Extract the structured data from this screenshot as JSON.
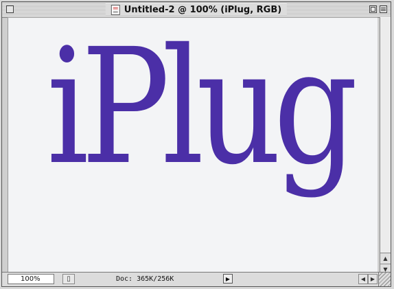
{
  "window": {
    "title": "Untitled-2 @ 100% (iPlug, RGB)"
  },
  "canvas": {
    "logo_text": "iPlug",
    "logo_color": "#4b2fa7",
    "background": "#f3f4f6"
  },
  "status": {
    "zoom": "100%",
    "doc_size": "Doc: 365K/256K",
    "preview_icon": "page-icon",
    "menu_arrow_icon": "triangle-right-icon"
  },
  "icons": {
    "close": "close-box-icon",
    "zoom": "zoom-box-icon",
    "collapse": "collapse-box-icon",
    "document": "document-icon",
    "scroll_up": "▲",
    "scroll_down": "▼",
    "scroll_left": "◀",
    "scroll_right": "▶",
    "status_menu": "▶",
    "preview": "▯"
  }
}
